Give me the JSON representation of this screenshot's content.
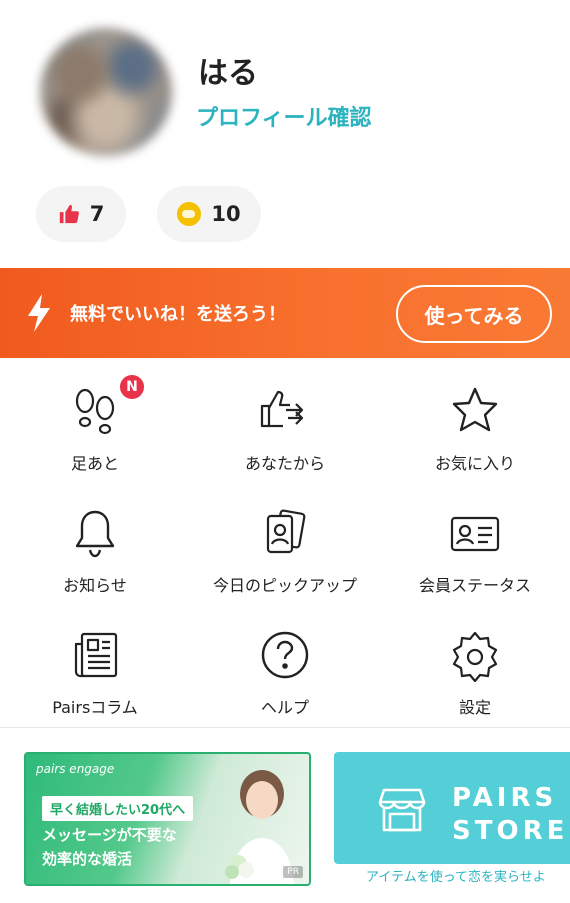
{
  "profile": {
    "name": "はる",
    "link_label": "プロフィール確認",
    "likes_count": "7",
    "points_count": "10"
  },
  "promo": {
    "text": "無料でいいね！を送ろう！",
    "button_label": "使ってみる",
    "color": "#f5631f"
  },
  "menu": {
    "footprints": {
      "label": "足あと",
      "badge": "N"
    },
    "from_you": {
      "label": "あなたから"
    },
    "favorites": {
      "label": "お気に入り"
    },
    "notifications": {
      "label": "お知らせ"
    },
    "todays_pickup": {
      "label": "今日のピックアップ"
    },
    "membership": {
      "label": "会員ステータス"
    },
    "column": {
      "label": "Pairsコラム"
    },
    "help": {
      "label": "ヘルプ"
    },
    "settings": {
      "label": "設定"
    }
  },
  "ads": {
    "engage": {
      "logo": "pairs engage",
      "tag": "早く結婚したい20代へ",
      "line1": "メッセージが不要な",
      "line2": "効率的な婚活",
      "pr": "PR"
    },
    "store": {
      "title_line1": "PAIRS",
      "title_line2": "STORE",
      "caption": "アイテムを使って恋を実らせよ"
    }
  },
  "colors": {
    "accent": "#2bb3c0",
    "badge": "#e8334a",
    "like": "#e8334a",
    "coin": "#f5c000"
  }
}
